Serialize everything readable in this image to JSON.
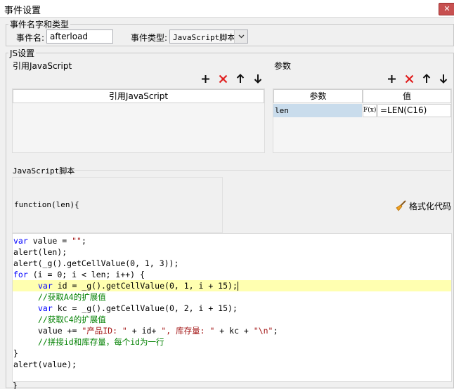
{
  "window": {
    "title": "事件设置",
    "close_glyph": "✕"
  },
  "name_group": {
    "legend": "事件名字和类型",
    "event_name_label": "事件名:",
    "event_name_value": "afterload",
    "event_type_label": "事件类型:",
    "event_type_value": "JavaScript脚本"
  },
  "js_group": {
    "legend": "JS设置"
  },
  "ref_js": {
    "section_label": "引用JavaScript",
    "column_header": "引用JavaScript",
    "toolbar": [
      "add-icon",
      "delete-icon",
      "move-up-icon",
      "move-down-icon"
    ]
  },
  "params": {
    "section_label": "参数",
    "headers": {
      "name": "参数",
      "value": "值"
    },
    "rows": [
      {
        "name": "len",
        "formula_btn": "F(x)",
        "value": "=LEN(C16)"
      }
    ],
    "toolbar": [
      "add-icon",
      "delete-icon",
      "move-up-icon",
      "move-down-icon"
    ]
  },
  "script": {
    "section_label": "JavaScript脚本",
    "signature": "function(len){",
    "format_button": "格式化代码",
    "lines": [
      {
        "indent": 0,
        "highlight": false,
        "tokens": [
          {
            "t": "var",
            "c": "kw"
          },
          {
            "t": " value = ",
            "c": ""
          },
          {
            "t": "\"\"",
            "c": "str"
          },
          {
            "t": ";",
            "c": ""
          }
        ]
      },
      {
        "indent": 0,
        "highlight": false,
        "tokens": [
          {
            "t": "alert(len);",
            "c": ""
          }
        ]
      },
      {
        "indent": 0,
        "highlight": false,
        "tokens": [
          {
            "t": "alert(_g().getCellValue(0, 1, 3));",
            "c": ""
          }
        ]
      },
      {
        "indent": 0,
        "highlight": false,
        "tokens": [
          {
            "t": "for",
            "c": "kw"
          },
          {
            "t": " (i = 0; i < len; i++) {",
            "c": ""
          }
        ]
      },
      {
        "indent": 1,
        "highlight": true,
        "tokens": [
          {
            "t": "var",
            "c": "kw"
          },
          {
            "t": " id = _g().getCellValue(0, 1, i + 15);",
            "c": ""
          }
        ]
      },
      {
        "indent": 1,
        "highlight": false,
        "tokens": [
          {
            "t": "//获取A4的扩展值",
            "c": "cmt"
          }
        ]
      },
      {
        "indent": 1,
        "highlight": false,
        "tokens": [
          {
            "t": "var",
            "c": "kw"
          },
          {
            "t": " kc = _g().getCellValue(0, 2, i + 15);",
            "c": ""
          }
        ]
      },
      {
        "indent": 1,
        "highlight": false,
        "tokens": [
          {
            "t": "//获取C4的扩展值",
            "c": "cmt"
          }
        ]
      },
      {
        "indent": 1,
        "highlight": false,
        "tokens": [
          {
            "t": "value += ",
            "c": ""
          },
          {
            "t": "\"产品ID: \"",
            "c": "str"
          },
          {
            "t": " + id+ ",
            "c": ""
          },
          {
            "t": "\", 库存量: \"",
            "c": "str"
          },
          {
            "t": " + kc + ",
            "c": ""
          },
          {
            "t": "\"\\n\"",
            "c": "str"
          },
          {
            "t": ";",
            "c": ""
          }
        ]
      },
      {
        "indent": 1,
        "highlight": false,
        "tokens": [
          {
            "t": "//拼接id和库存量，每个id为一行",
            "c": "cmt"
          }
        ]
      },
      {
        "indent": 0,
        "highlight": false,
        "tokens": [
          {
            "t": "}",
            "c": ""
          }
        ]
      },
      {
        "indent": 0,
        "highlight": false,
        "tokens": [
          {
            "t": "alert(value);",
            "c": ""
          }
        ]
      }
    ],
    "closing": "}"
  }
}
